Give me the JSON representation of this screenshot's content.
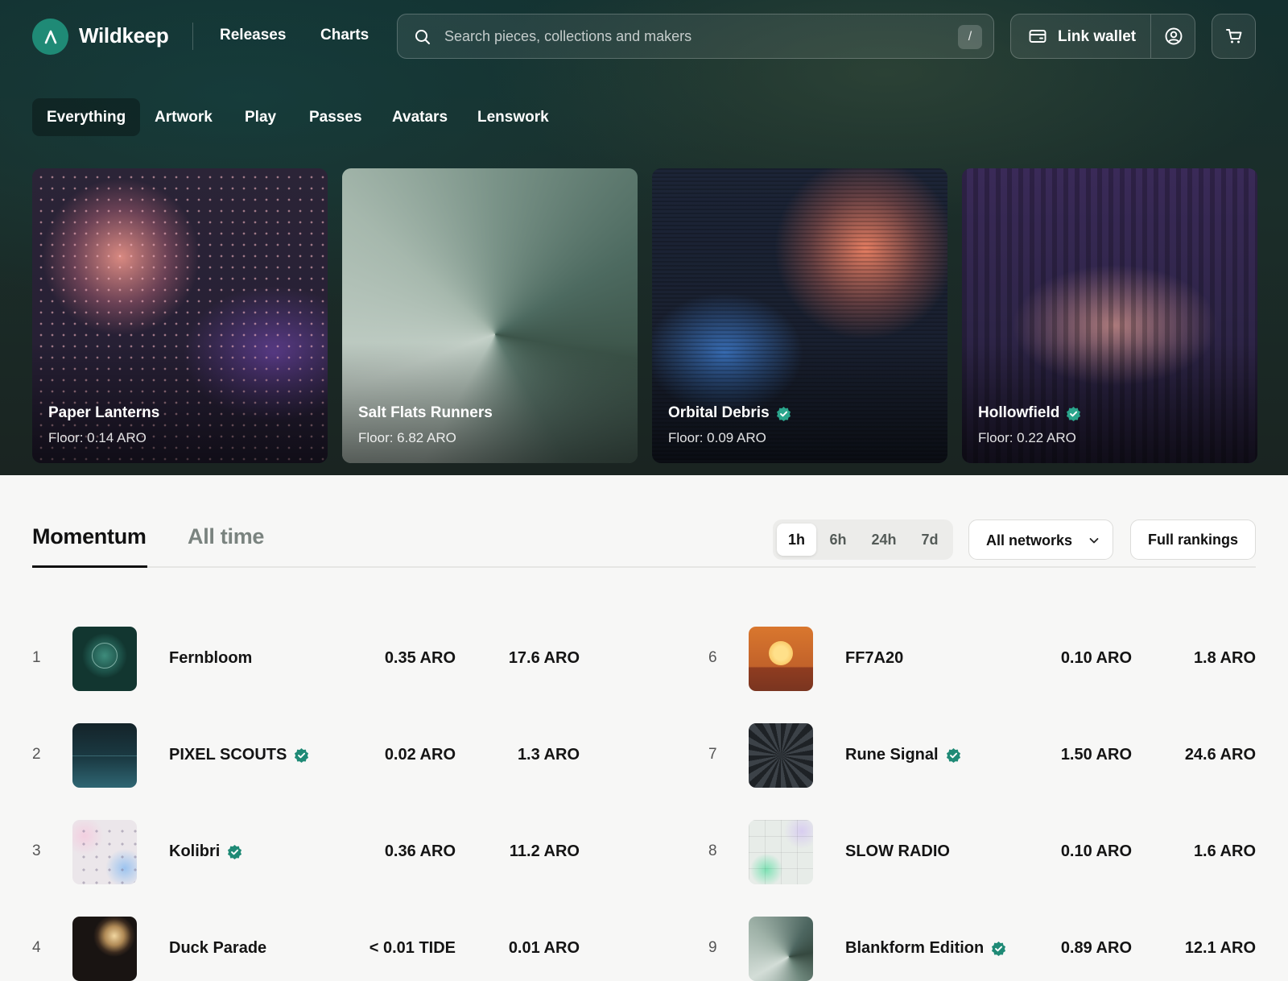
{
  "brand": {
    "name": "Wildkeep"
  },
  "nav": {
    "releases": "Releases",
    "charts": "Charts"
  },
  "search": {
    "placeholder": "Search pieces, collections and makers",
    "shortcut": "/"
  },
  "header": {
    "wallet_label": "Link wallet"
  },
  "categories": [
    "Everything",
    "Artwork",
    "Play",
    "Passes",
    "Avatars",
    "Lenswork"
  ],
  "featured": [
    {
      "title": "Paper Lanterns",
      "floor": "Floor: 0.14 ARO",
      "verified": false
    },
    {
      "title": "Salt Flats Runners",
      "floor": "Floor: 6.82 ARO",
      "verified": false
    },
    {
      "title": "Orbital Debris",
      "floor": "Floor: 0.09 ARO",
      "verified": true
    },
    {
      "title": "Hollowfield",
      "floor": "Floor: 0.22 ARO",
      "verified": true
    }
  ],
  "rankings": {
    "tabs": [
      "Momentum",
      "All time"
    ],
    "ranges": [
      "1h",
      "6h",
      "24h",
      "7d"
    ],
    "selected_range": "1h",
    "network_select": "All networks",
    "full_rankings_label": "Full rankings",
    "rows": [
      {
        "rank": "1",
        "name": "Fernbloom",
        "verified": false,
        "floor": "0.35 ARO",
        "volume": "17.6 ARO"
      },
      {
        "rank": "2",
        "name": "PIXEL SCOUTS",
        "verified": true,
        "floor": "0.02 ARO",
        "volume": "1.3 ARO"
      },
      {
        "rank": "3",
        "name": "Kolibri",
        "verified": true,
        "floor": "0.36 ARO",
        "volume": "11.2 ARO"
      },
      {
        "rank": "4",
        "name": "Duck Parade",
        "verified": false,
        "floor": "< 0.01 TIDE",
        "volume": "0.01 ARO"
      },
      {
        "rank": "6",
        "name": "FF7A20",
        "verified": false,
        "floor": "0.10 ARO",
        "volume": "1.8 ARO"
      },
      {
        "rank": "7",
        "name": "Rune Signal",
        "verified": true,
        "floor": "1.50 ARO",
        "volume": "24.6 ARO"
      },
      {
        "rank": "8",
        "name": "SLOW RADIO",
        "verified": false,
        "floor": "0.10 ARO",
        "volume": "1.6 ARO"
      },
      {
        "rank": "9",
        "name": "Blankform Edition",
        "verified": true,
        "floor": "0.89 ARO",
        "volume": "12.1 ARO"
      }
    ]
  },
  "colors": {
    "accent": "#1f8a76",
    "verified": "#1f8a76",
    "hero_bg": "#1b2e2a",
    "page_bg": "#f7f7f6"
  },
  "icons": [
    "logo-mark-icon",
    "search-icon",
    "wallet-icon",
    "profile-icon",
    "cart-icon",
    "chevron-down-icon",
    "verified-icon"
  ]
}
